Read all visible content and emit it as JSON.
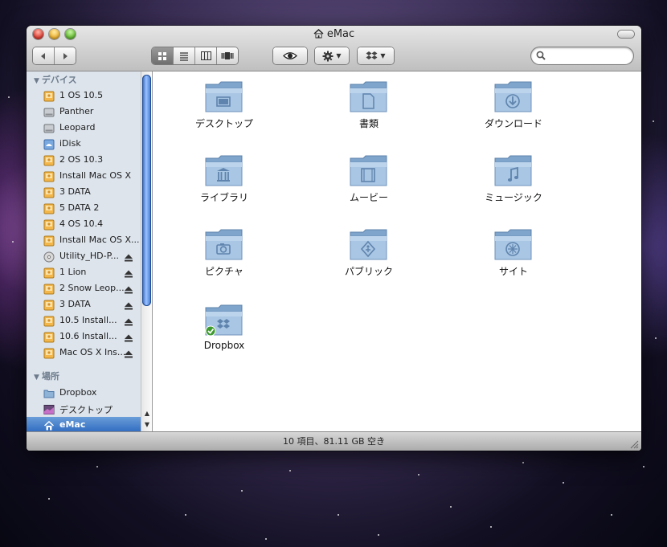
{
  "window": {
    "title": "eMac"
  },
  "toolbar": {
    "back": "back-arrow",
    "forward": "forward-arrow",
    "views": [
      "icon-view",
      "list-view",
      "column-view",
      "coverflow-view"
    ],
    "active_view": 0,
    "search_placeholder": ""
  },
  "sidebar": {
    "devices_header": "デバイス",
    "devices": [
      {
        "label": "1 OS 10.5",
        "icon": "disk-orange",
        "eject": false
      },
      {
        "label": "Panther",
        "icon": "disk-grey",
        "eject": false
      },
      {
        "label": "Leopard",
        "icon": "disk-grey",
        "eject": false
      },
      {
        "label": "iDisk",
        "icon": "idisk",
        "eject": false
      },
      {
        "label": "2 OS 10.3",
        "icon": "disk-orange",
        "eject": false
      },
      {
        "label": "Install Mac OS X",
        "icon": "disk-orange",
        "eject": false
      },
      {
        "label": "3 DATA",
        "icon": "disk-orange",
        "eject": false
      },
      {
        "label": "5 DATA 2",
        "icon": "disk-orange",
        "eject": false
      },
      {
        "label": "4 OS 10.4",
        "icon": "disk-orange",
        "eject": false
      },
      {
        "label": "Install Mac OS X...",
        "icon": "disk-orange",
        "eject": false
      },
      {
        "label": "Utility_HD-P...",
        "icon": "cd",
        "eject": true
      },
      {
        "label": "1 Lion",
        "icon": "disk-orange",
        "eject": true
      },
      {
        "label": "2 Snow Leop...",
        "icon": "disk-orange",
        "eject": true
      },
      {
        "label": "3 DATA",
        "icon": "disk-orange",
        "eject": true
      },
      {
        "label": "10.5 Install...",
        "icon": "disk-orange",
        "eject": true
      },
      {
        "label": "10.6 Install...",
        "icon": "disk-orange",
        "eject": true
      },
      {
        "label": "Mac OS X Ins...",
        "icon": "disk-orange",
        "eject": true
      }
    ],
    "places_header": "場所",
    "places": [
      {
        "label": "Dropbox",
        "icon": "folder",
        "selected": false
      },
      {
        "label": "デスクトップ",
        "icon": "desktop",
        "selected": false
      },
      {
        "label": "eMac",
        "icon": "home",
        "selected": true
      }
    ]
  },
  "items": [
    {
      "label": "デスクトップ",
      "glyph": "desktop"
    },
    {
      "label": "書類",
      "glyph": "document"
    },
    {
      "label": "ダウンロード",
      "glyph": "download"
    },
    {
      "label": "ライブラリ",
      "glyph": "library"
    },
    {
      "label": "ムービー",
      "glyph": "movie"
    },
    {
      "label": "ミュージック",
      "glyph": "music"
    },
    {
      "label": "ピクチャ",
      "glyph": "camera"
    },
    {
      "label": "パブリック",
      "glyph": "public"
    },
    {
      "label": "サイト",
      "glyph": "sites"
    },
    {
      "label": "Dropbox",
      "glyph": "dropbox"
    }
  ],
  "status": {
    "text": "10 項目、81.11 GB 空き"
  },
  "colors": {
    "selection": "#2c68bf",
    "folder": "#8fb3d6",
    "sidebar_bg": "#dde4ec"
  }
}
